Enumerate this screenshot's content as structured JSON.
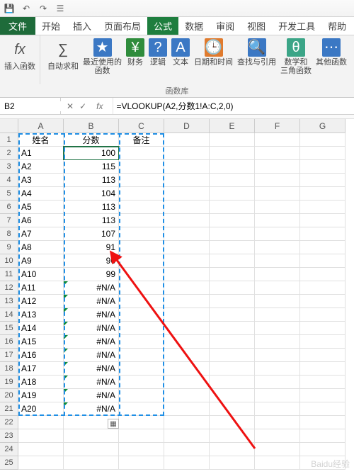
{
  "qat": {
    "save_icon": "💾",
    "undo_icon": "↶",
    "redo_icon": "↷",
    "touch_icon": "☰"
  },
  "tabs": {
    "file": "文件",
    "home": "开始",
    "insert": "插入",
    "layout": "页面布局",
    "formulas": "公式",
    "data": "数据",
    "review": "审阅",
    "view": "视图",
    "dev": "开发工具",
    "help": "帮助"
  },
  "ribbon": {
    "insert_fn": "插入函数",
    "autosum": "自动求和",
    "recent": "最近使用的\n函数",
    "financial": "财务",
    "logical": "逻辑",
    "text": "文本",
    "datetime": "日期和时间",
    "lookup": "查找与引用",
    "math": "数学和\n三角函数",
    "more": "其他函数",
    "group_label": "函数库"
  },
  "namebox": {
    "value": "B2"
  },
  "formula": {
    "cancel": "✕",
    "enter": "✓",
    "fx": "fx",
    "value": "=VLOOKUP(A2,分数1!A:C,2,0)"
  },
  "columns": [
    "A",
    "B",
    "C",
    "D",
    "E",
    "F",
    "G"
  ],
  "headers": {
    "a": "姓名",
    "b": "分数",
    "c": "备注"
  },
  "rows": [
    {
      "n": 1,
      "a": "姓名",
      "b": "分数",
      "c": "备注",
      "hdr": true
    },
    {
      "n": 2,
      "a": "A1",
      "b": "100"
    },
    {
      "n": 3,
      "a": "A2",
      "b": "115"
    },
    {
      "n": 4,
      "a": "A3",
      "b": "113"
    },
    {
      "n": 5,
      "a": "A4",
      "b": "104"
    },
    {
      "n": 6,
      "a": "A5",
      "b": "113"
    },
    {
      "n": 7,
      "a": "A6",
      "b": "113"
    },
    {
      "n": 8,
      "a": "A7",
      "b": "107"
    },
    {
      "n": 9,
      "a": "A8",
      "b": "91"
    },
    {
      "n": 10,
      "a": "A9",
      "b": "96"
    },
    {
      "n": 11,
      "a": "A10",
      "b": "99"
    },
    {
      "n": 12,
      "a": "A11",
      "b": "#N/A",
      "err": true
    },
    {
      "n": 13,
      "a": "A12",
      "b": "#N/A",
      "err": true
    },
    {
      "n": 14,
      "a": "A13",
      "b": "#N/A",
      "err": true
    },
    {
      "n": 15,
      "a": "A14",
      "b": "#N/A",
      "err": true
    },
    {
      "n": 16,
      "a": "A15",
      "b": "#N/A",
      "err": true
    },
    {
      "n": 17,
      "a": "A16",
      "b": "#N/A",
      "err": true
    },
    {
      "n": 18,
      "a": "A17",
      "b": "#N/A",
      "err": true
    },
    {
      "n": 19,
      "a": "A18",
      "b": "#N/A",
      "err": true
    },
    {
      "n": 20,
      "a": "A19",
      "b": "#N/A",
      "err": true
    },
    {
      "n": 21,
      "a": "A20",
      "b": "#N/A",
      "err": true
    },
    {
      "n": 22
    },
    {
      "n": 23
    },
    {
      "n": 24
    },
    {
      "n": 25
    }
  ],
  "watermark": "Baidu经验"
}
